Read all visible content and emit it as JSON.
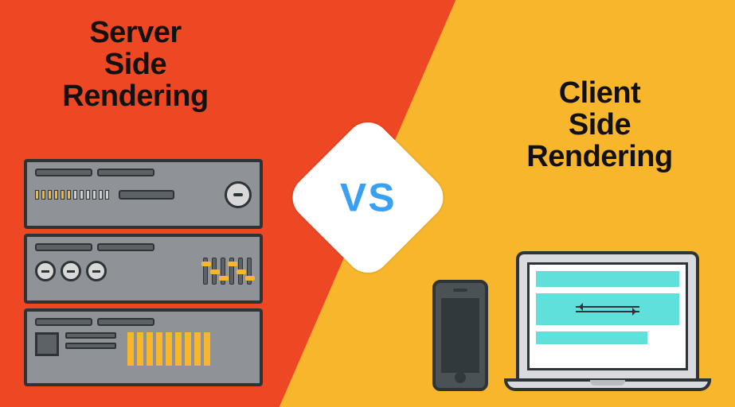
{
  "left": {
    "title_line1": "Server",
    "title_line2": "Side",
    "title_line3": "Rendering"
  },
  "right": {
    "title_line1": "Client",
    "title_line2": "Side",
    "title_line3": "Rendering"
  },
  "vs_label": "VS",
  "colors": {
    "left_bg": "#ee4723",
    "right_bg": "#f8b62d",
    "vs_text": "#3aa0f2",
    "screen_accent": "#5fe0da"
  },
  "icons": {
    "server": "server-rack-icon",
    "phone": "smartphone-icon",
    "laptop": "laptop-icon"
  }
}
